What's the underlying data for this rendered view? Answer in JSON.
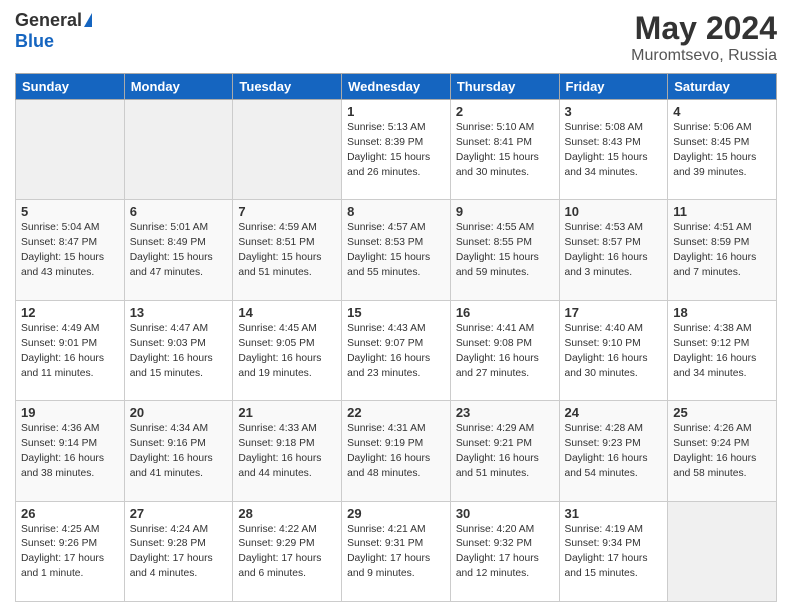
{
  "header": {
    "logo_general": "General",
    "logo_blue": "Blue",
    "title": "May 2024",
    "location": "Muromtsevo, Russia"
  },
  "days_of_week": [
    "Sunday",
    "Monday",
    "Tuesday",
    "Wednesday",
    "Thursday",
    "Friday",
    "Saturday"
  ],
  "weeks": [
    {
      "days": [
        {
          "num": "",
          "info": ""
        },
        {
          "num": "",
          "info": ""
        },
        {
          "num": "",
          "info": ""
        },
        {
          "num": "1",
          "info": "Sunrise: 5:13 AM\nSunset: 8:39 PM\nDaylight: 15 hours\nand 26 minutes."
        },
        {
          "num": "2",
          "info": "Sunrise: 5:10 AM\nSunset: 8:41 PM\nDaylight: 15 hours\nand 30 minutes."
        },
        {
          "num": "3",
          "info": "Sunrise: 5:08 AM\nSunset: 8:43 PM\nDaylight: 15 hours\nand 34 minutes."
        },
        {
          "num": "4",
          "info": "Sunrise: 5:06 AM\nSunset: 8:45 PM\nDaylight: 15 hours\nand 39 minutes."
        }
      ]
    },
    {
      "days": [
        {
          "num": "5",
          "info": "Sunrise: 5:04 AM\nSunset: 8:47 PM\nDaylight: 15 hours\nand 43 minutes."
        },
        {
          "num": "6",
          "info": "Sunrise: 5:01 AM\nSunset: 8:49 PM\nDaylight: 15 hours\nand 47 minutes."
        },
        {
          "num": "7",
          "info": "Sunrise: 4:59 AM\nSunset: 8:51 PM\nDaylight: 15 hours\nand 51 minutes."
        },
        {
          "num": "8",
          "info": "Sunrise: 4:57 AM\nSunset: 8:53 PM\nDaylight: 15 hours\nand 55 minutes."
        },
        {
          "num": "9",
          "info": "Sunrise: 4:55 AM\nSunset: 8:55 PM\nDaylight: 15 hours\nand 59 minutes."
        },
        {
          "num": "10",
          "info": "Sunrise: 4:53 AM\nSunset: 8:57 PM\nDaylight: 16 hours\nand 3 minutes."
        },
        {
          "num": "11",
          "info": "Sunrise: 4:51 AM\nSunset: 8:59 PM\nDaylight: 16 hours\nand 7 minutes."
        }
      ]
    },
    {
      "days": [
        {
          "num": "12",
          "info": "Sunrise: 4:49 AM\nSunset: 9:01 PM\nDaylight: 16 hours\nand 11 minutes."
        },
        {
          "num": "13",
          "info": "Sunrise: 4:47 AM\nSunset: 9:03 PM\nDaylight: 16 hours\nand 15 minutes."
        },
        {
          "num": "14",
          "info": "Sunrise: 4:45 AM\nSunset: 9:05 PM\nDaylight: 16 hours\nand 19 minutes."
        },
        {
          "num": "15",
          "info": "Sunrise: 4:43 AM\nSunset: 9:07 PM\nDaylight: 16 hours\nand 23 minutes."
        },
        {
          "num": "16",
          "info": "Sunrise: 4:41 AM\nSunset: 9:08 PM\nDaylight: 16 hours\nand 27 minutes."
        },
        {
          "num": "17",
          "info": "Sunrise: 4:40 AM\nSunset: 9:10 PM\nDaylight: 16 hours\nand 30 minutes."
        },
        {
          "num": "18",
          "info": "Sunrise: 4:38 AM\nSunset: 9:12 PM\nDaylight: 16 hours\nand 34 minutes."
        }
      ]
    },
    {
      "days": [
        {
          "num": "19",
          "info": "Sunrise: 4:36 AM\nSunset: 9:14 PM\nDaylight: 16 hours\nand 38 minutes."
        },
        {
          "num": "20",
          "info": "Sunrise: 4:34 AM\nSunset: 9:16 PM\nDaylight: 16 hours\nand 41 minutes."
        },
        {
          "num": "21",
          "info": "Sunrise: 4:33 AM\nSunset: 9:18 PM\nDaylight: 16 hours\nand 44 minutes."
        },
        {
          "num": "22",
          "info": "Sunrise: 4:31 AM\nSunset: 9:19 PM\nDaylight: 16 hours\nand 48 minutes."
        },
        {
          "num": "23",
          "info": "Sunrise: 4:29 AM\nSunset: 9:21 PM\nDaylight: 16 hours\nand 51 minutes."
        },
        {
          "num": "24",
          "info": "Sunrise: 4:28 AM\nSunset: 9:23 PM\nDaylight: 16 hours\nand 54 minutes."
        },
        {
          "num": "25",
          "info": "Sunrise: 4:26 AM\nSunset: 9:24 PM\nDaylight: 16 hours\nand 58 minutes."
        }
      ]
    },
    {
      "days": [
        {
          "num": "26",
          "info": "Sunrise: 4:25 AM\nSunset: 9:26 PM\nDaylight: 17 hours\nand 1 minute."
        },
        {
          "num": "27",
          "info": "Sunrise: 4:24 AM\nSunset: 9:28 PM\nDaylight: 17 hours\nand 4 minutes."
        },
        {
          "num": "28",
          "info": "Sunrise: 4:22 AM\nSunset: 9:29 PM\nDaylight: 17 hours\nand 6 minutes."
        },
        {
          "num": "29",
          "info": "Sunrise: 4:21 AM\nSunset: 9:31 PM\nDaylight: 17 hours\nand 9 minutes."
        },
        {
          "num": "30",
          "info": "Sunrise: 4:20 AM\nSunset: 9:32 PM\nDaylight: 17 hours\nand 12 minutes."
        },
        {
          "num": "31",
          "info": "Sunrise: 4:19 AM\nSunset: 9:34 PM\nDaylight: 17 hours\nand 15 minutes."
        },
        {
          "num": "",
          "info": ""
        }
      ]
    }
  ]
}
